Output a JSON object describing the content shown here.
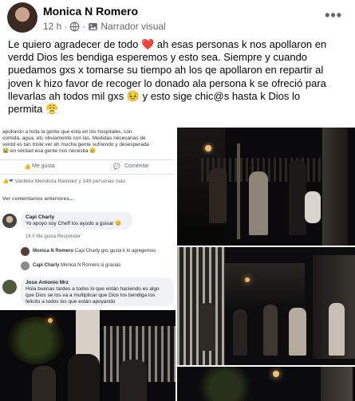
{
  "post": {
    "author": "Monica N Romero",
    "time": "12 h",
    "audience_icon": "globe-icon",
    "badge_label": "Narrador visual",
    "badge_icon": "image-icon",
    "more_icon": "more-options-icon",
    "text_lines": [
      "Le quiero agradecer de todo ❤️ ah  esas personas k nos apollaron en",
      "verdd Dios les bendiga  esperemos y esto sea. Siempre y cuando",
      "puedamos gxs x tomarse su tiempo ah los qe apollaron en repartir al",
      "joven k hizo favor de recoger lo donado ala persona k se ofreció para",
      "llevarlas  ah todos mil gxs 😣 y esto sige chic@s hasta k Dios lo",
      "permita 😤"
    ]
  },
  "screenshot": {
    "post_lines": [
      "apollaron a toda la gente que esta en los hospitales, con",
      "comida, agua, etc obviamente con las. Medidas necesarias de",
      "verdd es tan triste ver ah mucha gente sufriendo y desesperada",
      "😭 en verdad esa gente nos necesita 😢"
    ],
    "like_label": "Me gusta",
    "comment_label": "Comentar",
    "reactions_text": "Vanllelix Mendoza Ramirez y 149 personas más",
    "view_more": "Ver comentarios anteriores...",
    "comments": [
      {
        "name": "Capi Charly",
        "text": "Yo apoyo soy Cheff los ayudo a guisar 😊",
        "actions": "16 h   Me gusta   Responder"
      },
      {
        "name": "Jose Antonio Mrz",
        "text": "Hola buenas tardes a todos lo que están haciendo es algo que Dios se los va a multiplicar que Dios los bendiga los felicito a todos los que están apoyando",
        "actions": ""
      }
    ],
    "replies": [
      {
        "name": "Monica N Romero",
        "text": "Capi Charly gxs gusta k lo agregemos"
      },
      {
        "name": "Capi Charly",
        "text": "Monica N Romero si gracias"
      }
    ]
  },
  "photos": [
    {
      "alt": "night scene with people outside building"
    },
    {
      "alt": "people gathered at fence at night"
    },
    {
      "alt": "group outside hospital gate"
    },
    {
      "alt": "lit tree outside building at night"
    },
    {
      "alt": "people at night near lights"
    }
  ]
}
